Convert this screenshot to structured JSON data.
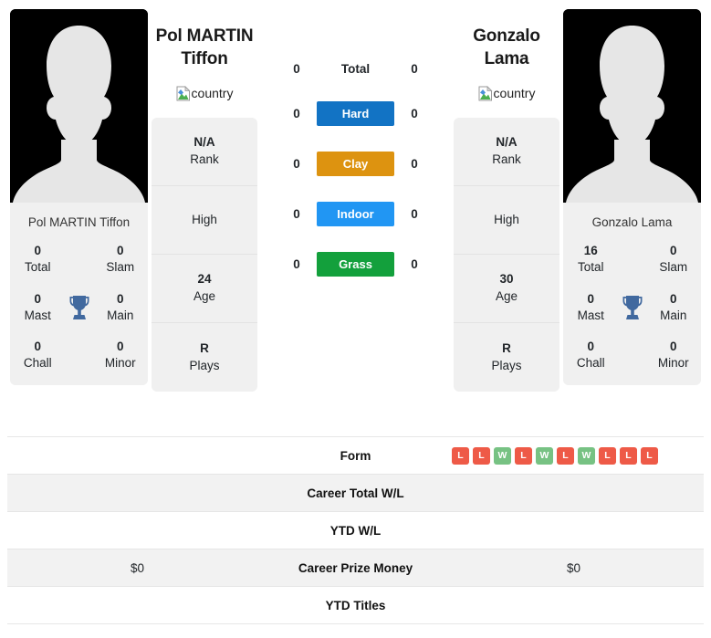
{
  "players": {
    "left": {
      "name": "Pol MARTIN Tiffon",
      "name_line1": "Pol MARTIN",
      "name_line2": "Tiffon",
      "country_alt": "country",
      "photo_alt": "player-photo",
      "stats": [
        {
          "value": "0",
          "label": "Total"
        },
        {
          "value": "0",
          "label": "Slam"
        },
        {
          "value": "0",
          "label": "Mast"
        },
        {
          "value": "0",
          "label": "Main"
        },
        {
          "value": "0",
          "label": "Chall"
        },
        {
          "value": "0",
          "label": "Minor"
        }
      ],
      "info": [
        {
          "value": "N/A",
          "label": "Rank"
        },
        {
          "value": "",
          "label": "High"
        },
        {
          "value": "24",
          "label": "Age"
        },
        {
          "value": "R",
          "label": "Plays"
        }
      ]
    },
    "right": {
      "name": "Gonzalo Lama",
      "name_line1": "Gonzalo",
      "name_line2": "Lama",
      "country_alt": "country",
      "photo_alt": "player-photo",
      "stats": [
        {
          "value": "16",
          "label": "Total"
        },
        {
          "value": "0",
          "label": "Slam"
        },
        {
          "value": "0",
          "label": "Mast"
        },
        {
          "value": "0",
          "label": "Main"
        },
        {
          "value": "0",
          "label": "Chall"
        },
        {
          "value": "0",
          "label": "Minor"
        }
      ],
      "info": [
        {
          "value": "N/A",
          "label": "Rank"
        },
        {
          "value": "",
          "label": "High"
        },
        {
          "value": "30",
          "label": "Age"
        },
        {
          "value": "R",
          "label": "Plays"
        }
      ]
    }
  },
  "surfaces": [
    {
      "label": "Total",
      "left": "0",
      "right": "0",
      "color": "",
      "style": "plain"
    },
    {
      "label": "Hard",
      "left": "0",
      "right": "0",
      "color": "#1273c4",
      "style": "badge"
    },
    {
      "label": "Clay",
      "left": "0",
      "right": "0",
      "color": "#dd9310",
      "style": "badge"
    },
    {
      "label": "Indoor",
      "left": "0",
      "right": "0",
      "color": "#2196f3",
      "style": "badge"
    },
    {
      "label": "Grass",
      "left": "0",
      "right": "0",
      "color": "#13a03c",
      "style": "badge"
    }
  ],
  "table_rows": [
    {
      "label": "Form",
      "left": "",
      "right": "",
      "type": "form",
      "shaded": false
    },
    {
      "label": "Career Total W/L",
      "left": "",
      "right": "",
      "type": "text",
      "shaded": true
    },
    {
      "label": "YTD W/L",
      "left": "",
      "right": "",
      "type": "text",
      "shaded": false
    },
    {
      "label": "Career Prize Money",
      "left": "$0",
      "right": "$0",
      "type": "text",
      "shaded": true
    },
    {
      "label": "YTD Titles",
      "left": "",
      "right": "",
      "type": "text",
      "shaded": false
    }
  ],
  "form": {
    "right_results": [
      "L",
      "L",
      "W",
      "L",
      "W",
      "L",
      "W",
      "L",
      "L",
      "L"
    ],
    "left_results": [],
    "colors": {
      "win": "#77c283",
      "loss": "#ee5a47"
    }
  },
  "theme": {
    "card_bg": "#f0f0f0",
    "row_shaded": "#f2f2f2",
    "trophy_color": "#41699f",
    "photo_bg": "#000000"
  }
}
